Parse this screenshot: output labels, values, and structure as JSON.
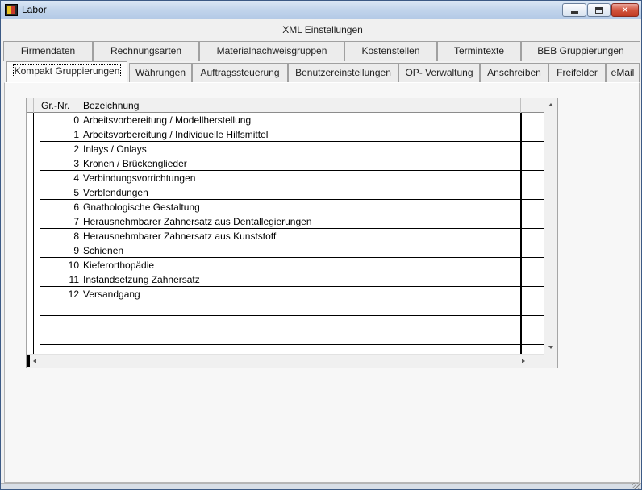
{
  "window": {
    "title": "Labor"
  },
  "section_title": "XML Einstellungen",
  "tabs_row1": [
    {
      "label": "Firmendaten"
    },
    {
      "label": "Rechnungsarten"
    },
    {
      "label": "Materialnachweisgruppen"
    },
    {
      "label": "Kostenstellen"
    },
    {
      "label": "Termintexte"
    },
    {
      "label": "BEB Gruppierungen"
    }
  ],
  "tabs_row2": [
    {
      "label": "Kompakt Gruppierungen",
      "active": true
    },
    {
      "label": "Währungen"
    },
    {
      "label": "Auftragssteuerung"
    },
    {
      "label": "Benutzereinstellungen"
    },
    {
      "label": "OP- Verwaltung"
    },
    {
      "label": "Anschreiben"
    },
    {
      "label": "Freifelder"
    },
    {
      "label": "eMail"
    }
  ],
  "grid": {
    "columns": {
      "nr": "Gr.-Nr.",
      "bezeichnung": "Bezeichnung"
    },
    "rows": [
      {
        "nr": "0",
        "bezeichnung": "Arbeitsvorbereitung / Modellherstellung"
      },
      {
        "nr": "1",
        "bezeichnung": "Arbeitsvorbereitung / Individuelle Hilfsmittel"
      },
      {
        "nr": "2",
        "bezeichnung": "Inlays / Onlays"
      },
      {
        "nr": "3",
        "bezeichnung": "Kronen / Brückenglieder"
      },
      {
        "nr": "4",
        "bezeichnung": "Verbindungsvorrichtungen"
      },
      {
        "nr": "5",
        "bezeichnung": "Verblendungen"
      },
      {
        "nr": "6",
        "bezeichnung": "Gnathologische Gestaltung"
      },
      {
        "nr": "7",
        "bezeichnung": "Herausnehmbarer Zahnersatz aus Dentallegierungen"
      },
      {
        "nr": "8",
        "bezeichnung": "Herausnehmbarer Zahnersatz aus Kunststoff"
      },
      {
        "nr": "9",
        "bezeichnung": "Schienen"
      },
      {
        "nr": "10",
        "bezeichnung": "Kieferorthopädie"
      },
      {
        "nr": "11",
        "bezeichnung": "Instandsetzung Zahnersatz"
      },
      {
        "nr": "12",
        "bezeichnung": "Versandgang"
      },
      {
        "nr": "",
        "bezeichnung": ""
      },
      {
        "nr": "",
        "bezeichnung": ""
      },
      {
        "nr": "",
        "bezeichnung": ""
      },
      {
        "nr": "",
        "bezeichnung": ""
      }
    ]
  }
}
